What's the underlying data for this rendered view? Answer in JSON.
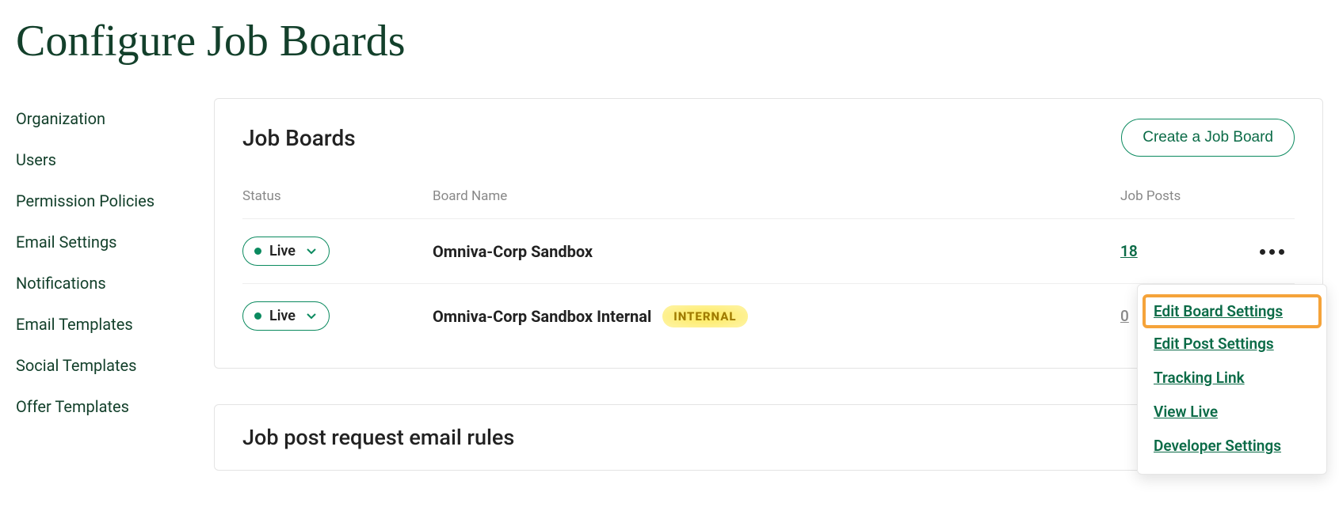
{
  "page": {
    "title": "Configure Job Boards"
  },
  "sidebar": {
    "items": [
      {
        "label": "Organization"
      },
      {
        "label": "Users"
      },
      {
        "label": "Permission Policies"
      },
      {
        "label": "Email Settings"
      },
      {
        "label": "Notifications"
      },
      {
        "label": "Email Templates"
      },
      {
        "label": "Social Templates"
      },
      {
        "label": "Offer Templates"
      }
    ]
  },
  "main": {
    "boards_card": {
      "title": "Job Boards",
      "create_button": "Create a Job Board",
      "columns": {
        "status": "Status",
        "board_name": "Board Name",
        "job_posts": "Job Posts"
      },
      "rows": [
        {
          "status": "Live",
          "name": "Omniva-Corp Sandbox",
          "posts": "18",
          "posts_muted": false
        },
        {
          "status": "Live",
          "name": "Omniva-Corp Sandbox Internal",
          "badge": "INTERNAL",
          "posts": "0",
          "posts_muted": true
        }
      ]
    },
    "email_rules_card": {
      "title": "Job post request email rules"
    },
    "row_menu": {
      "items": [
        {
          "label": "Edit Board Settings",
          "highlighted": true
        },
        {
          "label": "Edit Post Settings"
        },
        {
          "label": "Tracking Link"
        },
        {
          "label": "View Live"
        },
        {
          "label": "Developer Settings"
        }
      ]
    }
  }
}
